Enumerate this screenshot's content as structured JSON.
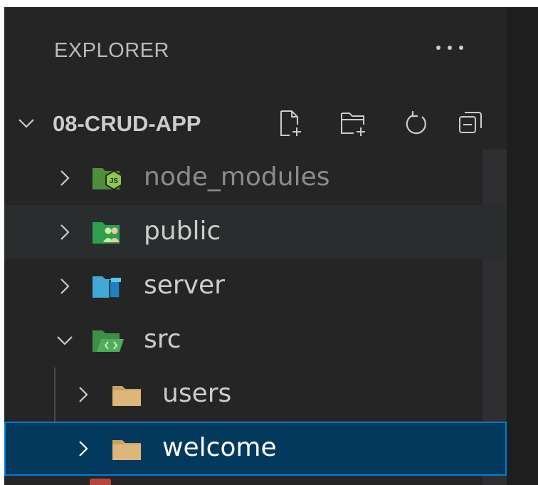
{
  "explorer": {
    "title": "EXPLORER",
    "more_actions_icon": "ellipsis-icon"
  },
  "project": {
    "name": "08-CRUD-APP",
    "expanded": true,
    "actions": [
      {
        "name": "new-file",
        "icon": "new-file-icon"
      },
      {
        "name": "new-folder",
        "icon": "new-folder-icon"
      },
      {
        "name": "refresh",
        "icon": "refresh-icon"
      },
      {
        "name": "collapse-all",
        "icon": "collapse-all-icon"
      }
    ]
  },
  "tree": [
    {
      "label": "node_modules",
      "expanded": false,
      "level": 1,
      "icon": "nodejs-folder-icon",
      "dimmed": true,
      "state": "normal"
    },
    {
      "label": "public",
      "expanded": false,
      "level": 1,
      "icon": "public-folder-icon",
      "dimmed": false,
      "state": "hovered"
    },
    {
      "label": "server",
      "expanded": false,
      "level": 1,
      "icon": "server-folder-icon",
      "dimmed": false,
      "state": "normal"
    },
    {
      "label": "src",
      "expanded": true,
      "level": 1,
      "icon": "src-folder-icon",
      "dimmed": false,
      "state": "normal"
    },
    {
      "label": "users",
      "expanded": false,
      "level": 2,
      "icon": "folder-icon",
      "dimmed": false,
      "state": "normal"
    },
    {
      "label": "welcome",
      "expanded": false,
      "level": 2,
      "icon": "folder-icon",
      "dimmed": false,
      "state": "selected"
    }
  ],
  "colors": {
    "sidebar_bg": "#252526",
    "selection_bg": "#04395e",
    "selection_border": "#007fd4",
    "hover_bg": "#2a2d2e",
    "text": "#cccccc",
    "dimmed_text": "#8c8c8c",
    "folder_yellow": "#dcb67a",
    "folder_green": "#4caf50",
    "folder_blue": "#2f9ed8"
  }
}
